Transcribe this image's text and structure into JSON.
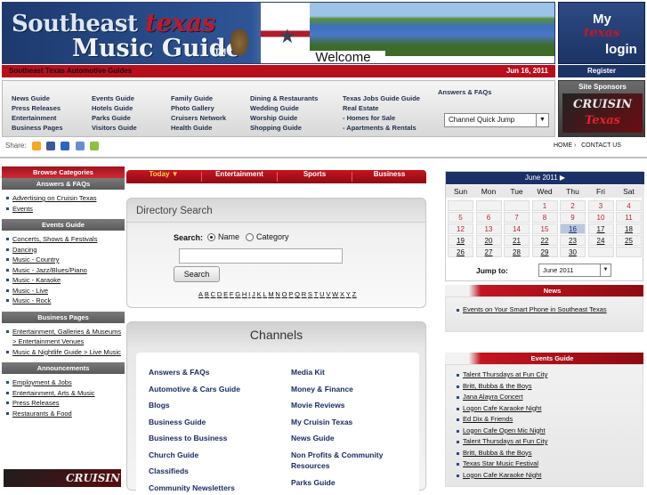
{
  "header": {
    "logo_top": "Southeast",
    "logo_texas": "texas",
    "logo_bottom": "Music Guide",
    "logo_tm": "TM",
    "welcome": "Welcome",
    "login_my": "My",
    "login_texas": "texas",
    "login_label": "login",
    "redbar_link": "Southeast Texas Automotive Guides",
    "date": "Jun 16, 2011",
    "register": "Register"
  },
  "nav": {
    "col1": [
      "News Guide",
      "Press Releases",
      "Entertainment",
      "Business Pages"
    ],
    "col2": [
      "Events Guide",
      "Hotels Guide",
      "Parks Guide",
      "Visitors Guide"
    ],
    "col3": [
      "Family Guide",
      "Photo Gallery",
      "Cruisers Network",
      "Health Guide"
    ],
    "col4": [
      "Dining & Restaurants",
      "Wedding Guide",
      "Worship Guide",
      "Shopping Guide"
    ],
    "col5": [
      "Texas Jobs Guide Guide",
      "Real Estate",
      "- Homes for Sale",
      "- Apartments & Rentals"
    ],
    "answers": "Answers & FAQs",
    "quick_jump": "Channel Quick Jump"
  },
  "sponsors": {
    "title": "Site Sponsors",
    "ad_line1": "CRUISIN",
    "ad_line2": "Texas"
  },
  "share": {
    "label": "Share:",
    "home": "HOME",
    "contact": "CONTACT US"
  },
  "left": {
    "browse": "Browse Categories",
    "sections": [
      {
        "title": "Answers & FAQs",
        "items": [
          "Advertising on Cruisin Texas",
          "Events"
        ]
      },
      {
        "title": "Events Guide",
        "items": [
          "Concerts, Shows & Festivals",
          "Dancing",
          "Music - Country",
          "Music - Jazz/Blues/Piano",
          "Music - Karaoke",
          "Music - Live",
          "Music - Rock"
        ]
      },
      {
        "title": "Business Pages",
        "items": [
          "Entertainment, Galleries & Museums > Entertainment Venues",
          "Music & Nightlife Guide > Live Music"
        ]
      },
      {
        "title": "Announcements",
        "items": [
          "Employment & Jobs",
          "Entertainment, Arts & Music",
          "Press Releases",
          "Restaurants & Food"
        ]
      }
    ],
    "bottom_ad": "CRUISIN"
  },
  "tabs": [
    "Today",
    "Entertainment",
    "Sports",
    "Business"
  ],
  "directory": {
    "title": "Directory Search",
    "search_label": "Search:",
    "opt_name": "Name",
    "opt_category": "Category",
    "button": "Search",
    "letters": [
      "A",
      "B",
      "C",
      "D",
      "E",
      "F",
      "G",
      "H",
      "I",
      "J",
      "K",
      "L",
      "M",
      "N",
      "O",
      "P",
      "Q",
      "R",
      "S",
      "T",
      "U",
      "V",
      "W",
      "X",
      "Y",
      "Z"
    ]
  },
  "channels": {
    "title": "Channels",
    "left": [
      "Answers & FAQs",
      "Automotive & Cars Guide",
      "Blogs",
      "Business Guide",
      "Business to Business",
      "Church Guide",
      "Classifieds",
      "Community Newsletters"
    ],
    "right": [
      "Media Kit",
      "Money & Finance",
      "Movie Reviews",
      "My Cruisin Texas",
      "News Guide",
      "Non Profits & Community Resources",
      "Parks Guide"
    ]
  },
  "calendar": {
    "month": "June 2011",
    "next_arrow": "▶",
    "dow": [
      "Sun",
      "Mon",
      "Tue",
      "Wed",
      "Thu",
      "Fri",
      "Sat"
    ],
    "weeks": [
      [
        "",
        "",
        "",
        "1",
        "2",
        "3",
        "4"
      ],
      [
        "5",
        "6",
        "7",
        "8",
        "9",
        "10",
        "11"
      ],
      [
        "12",
        "13",
        "14",
        "15",
        "16",
        "17",
        "18"
      ],
      [
        "19",
        "20",
        "21",
        "22",
        "23",
        "24",
        "25"
      ],
      [
        "26",
        "27",
        "28",
        "29",
        "30",
        "",
        ""
      ]
    ],
    "today": "16",
    "jump_label": "Jump to:",
    "jump_value": "June 2011"
  },
  "news": {
    "title": "News",
    "items": [
      "Events on Your Smart Phone in Southeast Texas"
    ]
  },
  "events": {
    "title": "Events Guide",
    "items": [
      "Talent Thursdays at Fun City",
      "Britt, Bubba & the Boys",
      "Jana Alayra Concert",
      "Logon Cafe Karaoke Night",
      "Ed Dix & Friends",
      "Logon Cafe Open Mic Night",
      "Talent Thursdays at Fun City",
      "Britt, Bubba & the Boys",
      "Texas Star Music Festival",
      "Logon Cafe Karaoke Night"
    ]
  }
}
